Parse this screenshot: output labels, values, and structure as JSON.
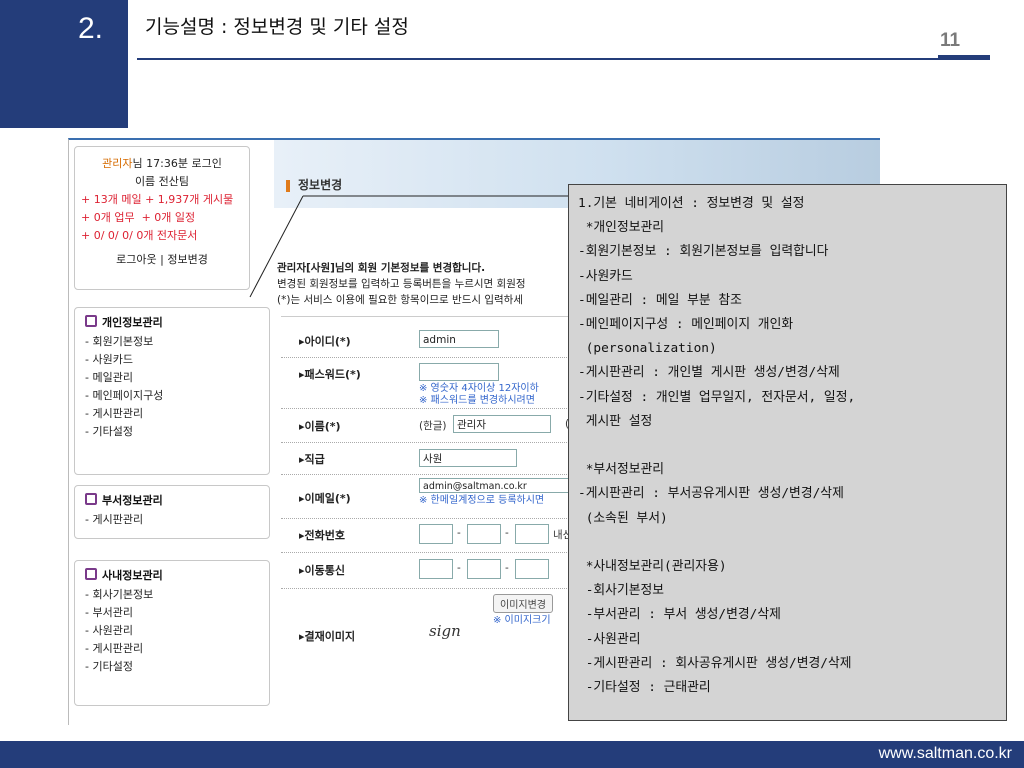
{
  "slide": {
    "number": "2.",
    "title": "기능설명 : 정보변경 및 기타 설정",
    "page": "11",
    "footer": "www.saltman.co.kr"
  },
  "login": {
    "line1_user": "관리자",
    "line1_rest": "님 17:36분 로그인",
    "line2": "이름 전산팀",
    "mail": "+ 13개 메일",
    "board": "+ 1,937개 게시물",
    "work": "+ 0개 업무",
    "schedule": "+ 0개 일정",
    "docs": "+ 0/ 0/ 0/ 0개 전자문서",
    "links": "로그아웃 | 정보변경"
  },
  "menu_personal": {
    "title": "개인정보관리",
    "items": [
      "- 회원기본정보",
      "- 사원카드",
      "- 메일관리",
      "- 메인페이지구성",
      "- 게시판관리",
      "- 기타설정"
    ]
  },
  "menu_dept": {
    "title": "부서정보관리",
    "items": [
      "- 게시판관리"
    ]
  },
  "menu_company": {
    "title": "사내정보관리",
    "items": [
      "- 회사기본정보",
      "- 부서관리",
      "- 사원관리",
      "- 게시판관리",
      "- 기타설정"
    ]
  },
  "page_header": "정보변경",
  "intro": {
    "line1": "관리자[사원]님의 회원 기본정보를 변경합니다.",
    "line2": "변경된 회원정보를 입력하고 등록버튼을 누르시면 회원정",
    "line3": "(*)는 서비스 이용에 필요한 항목이므로 반드시 입력하세"
  },
  "form": {
    "id_label": "▸아이디(*)",
    "id_value": "admin",
    "pw_label": "▸패스워드(*)",
    "pw_note1": "※ 영숫자 4자이상 12자이하",
    "pw_note2": "※ 패스워드를 변경하시려면",
    "name_label": "▸이름(*)",
    "name_prefix": "(한글)",
    "name_value": "관리자",
    "name_paren": "(",
    "rank_label": "▸직급",
    "rank_value": "사원",
    "email_label": "▸이메일(*)",
    "email_value": "admin@saltman.co.kr",
    "email_note": "※ 한메일계정으로 등록하시면",
    "phone_label": "▸전화번호",
    "phone_ext": "내선",
    "mobile_label": "▸이동통신",
    "sign_label": "▸결재이미지",
    "sign_button": "이미지변경",
    "sign_note": "※ 이미지크기",
    "sign_text": "sign"
  },
  "overlay_lines": [
    "1.기본 네비게이션 : 정보변경 및 설정",
    " *개인정보관리",
    "-회원기본정보 : 회원기본정보를 입력합니다",
    "-사원카드",
    "-메일관리 : 메일 부분 참조",
    "-메인페이지구성 : 메인페이지 개인화",
    " (personalization)",
    "-게시판관리 : 개인별 게시판 생성/변경/삭제",
    "-기타설정 : 개인별 업무일지, 전자문서, 일정,",
    " 게시판 설정",
    "",
    " *부서정보관리",
    "-게시판관리 : 부서공유게시판 생성/변경/삭제",
    " (소속된 부서)",
    "",
    " *사내정보관리(관리자용)",
    " -회사기본정보",
    " -부서관리 : 부서 생성/변경/삭제",
    " -사원관리",
    " -게시판관리 : 회사공유게시판 생성/변경/삭제",
    " -기타설정 : 근태관리"
  ]
}
